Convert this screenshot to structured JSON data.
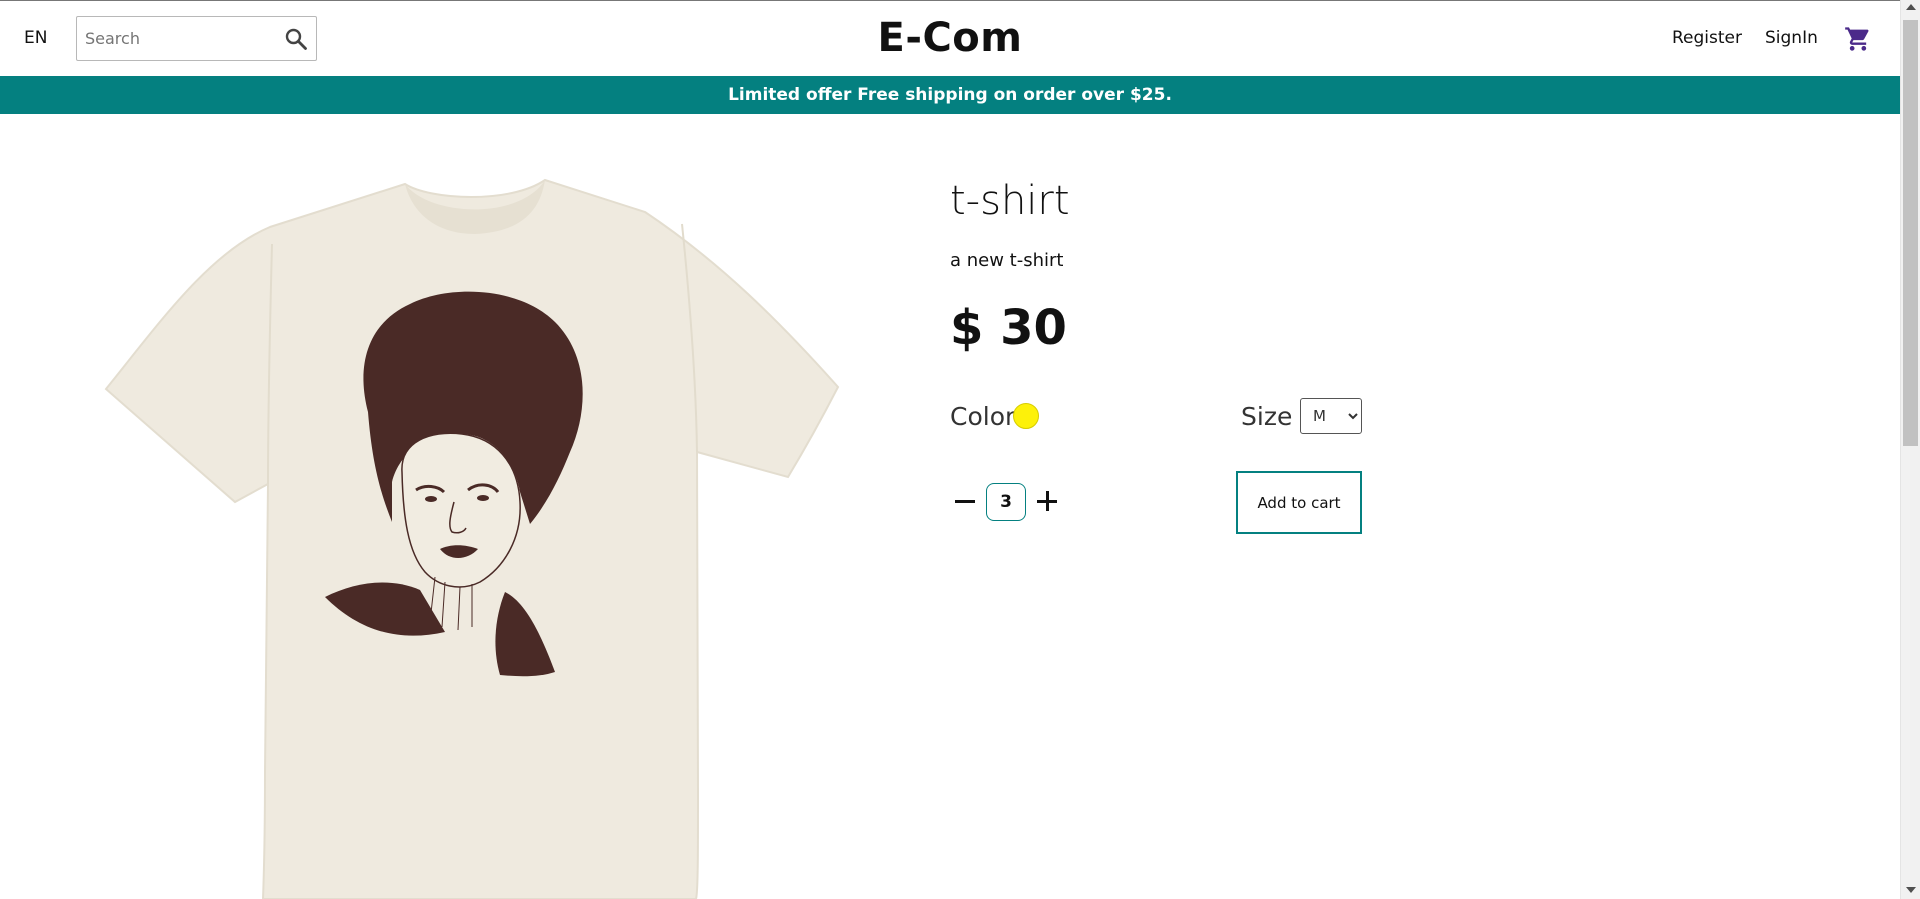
{
  "header": {
    "language": "EN",
    "search_placeholder": "Search",
    "brand": "E-Com",
    "register_label": "Register",
    "signin_label": "SignIn"
  },
  "banner": {
    "text": "Limited offer Free shipping on order over $25."
  },
  "product": {
    "title": "t-shirt",
    "description": "a new t-shirt",
    "price": "$ 30",
    "color_label": "Color",
    "color_value": "#fdf10a",
    "size_label": "Size",
    "size_selected": "M",
    "quantity": "3",
    "add_to_cart_label": "Add to cart",
    "image_subject": "cream t-shirt with dark brown portrait print"
  },
  "colors": {
    "accent": "#048080",
    "cart_icon": "#4b2a8a",
    "shirt": "#efeadf",
    "print": "#4a2a26"
  }
}
